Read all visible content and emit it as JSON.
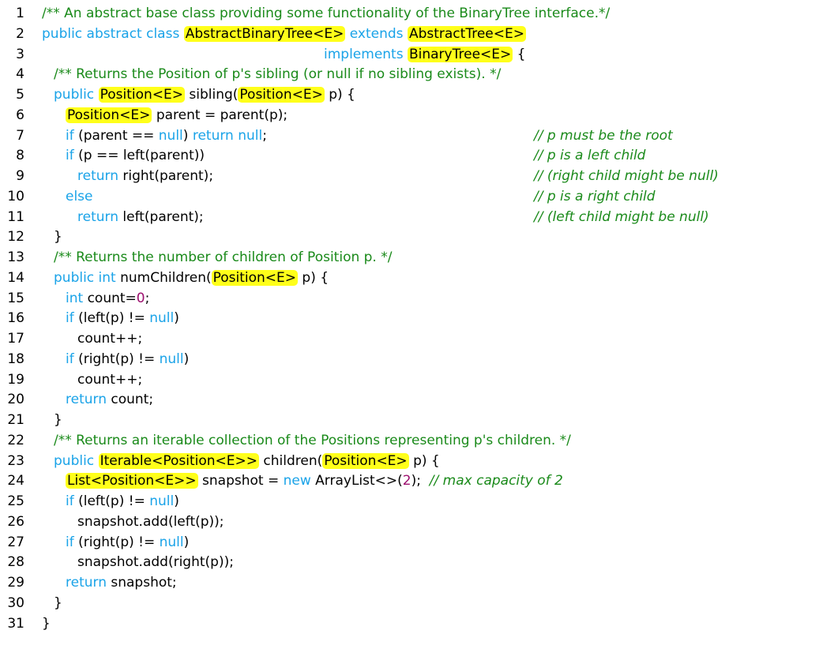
{
  "highlight_color": "#ffff1a",
  "keyword_color": "#1aa3e8",
  "comment_color": "#1a8a1a",
  "number_color": "#9c0f6e",
  "lines": [
    {
      "num": "1",
      "indent": 1,
      "tokens": [
        {
          "t": "/** An abstract base class providing some functionality of the BinaryTree interface.*/",
          "s": "c"
        }
      ]
    },
    {
      "num": "2",
      "indent": 1,
      "tokens": [
        {
          "t": "public abstract class",
          "s": "kw"
        },
        {
          "t": " ",
          "s": ""
        },
        {
          "t": "AbstractBinaryTree<E>",
          "s": "hl"
        },
        {
          "t": " ",
          "s": ""
        },
        {
          "t": "extends",
          "s": "kw"
        },
        {
          "t": " ",
          "s": ""
        },
        {
          "t": "AbstractTree<E>",
          "s": "hl"
        }
      ]
    },
    {
      "num": "3",
      "indent": 22,
      "tokens": [
        {
          "t": "implements",
          "s": "kw"
        },
        {
          "t": " ",
          "s": ""
        },
        {
          "t": "BinaryTree<E>",
          "s": "hl"
        },
        {
          "t": " {",
          "s": ""
        }
      ]
    },
    {
      "num": "4",
      "indent": 2,
      "tokens": [
        {
          "t": "/** Returns the Position of p's sibling (or null if no sibling exists). */",
          "s": "c"
        }
      ]
    },
    {
      "num": "5",
      "indent": 2,
      "tokens": [
        {
          "t": "public",
          "s": "kw"
        },
        {
          "t": " ",
          "s": ""
        },
        {
          "t": "Position<E>",
          "s": "hl"
        },
        {
          "t": " sibling(",
          "s": ""
        },
        {
          "t": "Position<E>",
          "s": "hl"
        },
        {
          "t": " p) {",
          "s": ""
        }
      ]
    },
    {
      "num": "6",
      "indent": 3,
      "tokens": [
        {
          "t": "Position<E>",
          "s": "hl"
        },
        {
          "t": " parent = parent(p);",
          "s": ""
        }
      ],
      "comment": ""
    },
    {
      "num": "7",
      "indent": 3,
      "tokens": [
        {
          "t": "if",
          "s": "kw"
        },
        {
          "t": " (parent == ",
          "s": ""
        },
        {
          "t": "null",
          "s": "kw"
        },
        {
          "t": ") ",
          "s": ""
        },
        {
          "t": "return null",
          "s": "kw"
        },
        {
          "t": ";",
          "s": ""
        }
      ],
      "comment": "// p must be the root"
    },
    {
      "num": "8",
      "indent": 3,
      "tokens": [
        {
          "t": "if",
          "s": "kw"
        },
        {
          "t": " (p == left(parent))",
          "s": ""
        }
      ],
      "comment": "// p is a left child"
    },
    {
      "num": "9",
      "indent": 4,
      "tokens": [
        {
          "t": "return",
          "s": "kw"
        },
        {
          "t": " right(parent);",
          "s": ""
        }
      ],
      "comment": "// (right child might be null)"
    },
    {
      "num": "10",
      "indent": 3,
      "tokens": [
        {
          "t": "else",
          "s": "kw"
        }
      ],
      "comment": "// p is a right child"
    },
    {
      "num": "11",
      "indent": 4,
      "tokens": [
        {
          "t": "return",
          "s": "kw"
        },
        {
          "t": " left(parent);",
          "s": ""
        }
      ],
      "comment": "// (left child might be null)"
    },
    {
      "num": "12",
      "indent": 2,
      "tokens": [
        {
          "t": "}",
          "s": ""
        }
      ]
    },
    {
      "num": "13",
      "indent": 2,
      "tokens": [
        {
          "t": "/** Returns the number of children of Position p. */",
          "s": "c"
        }
      ]
    },
    {
      "num": "14",
      "indent": 2,
      "tokens": [
        {
          "t": "public int",
          "s": "kw"
        },
        {
          "t": " numChildren(",
          "s": ""
        },
        {
          "t": "Position<E>",
          "s": "hl"
        },
        {
          "t": " p) {",
          "s": ""
        }
      ]
    },
    {
      "num": "15",
      "indent": 3,
      "tokens": [
        {
          "t": "int",
          "s": "kw"
        },
        {
          "t": " count=",
          "s": ""
        },
        {
          "t": "0",
          "s": "n"
        },
        {
          "t": ";",
          "s": ""
        }
      ]
    },
    {
      "num": "16",
      "indent": 3,
      "tokens": [
        {
          "t": "if",
          "s": "kw"
        },
        {
          "t": " (left(p) != ",
          "s": ""
        },
        {
          "t": "null",
          "s": "kw"
        },
        {
          "t": ")",
          "s": ""
        }
      ]
    },
    {
      "num": "17",
      "indent": 4,
      "tokens": [
        {
          "t": "count++;",
          "s": ""
        }
      ]
    },
    {
      "num": "18",
      "indent": 3,
      "tokens": [
        {
          "t": "if",
          "s": "kw"
        },
        {
          "t": " (right(p) != ",
          "s": ""
        },
        {
          "t": "null",
          "s": "kw"
        },
        {
          "t": ")",
          "s": ""
        }
      ]
    },
    {
      "num": "19",
      "indent": 4,
      "tokens": [
        {
          "t": "count++;",
          "s": ""
        }
      ]
    },
    {
      "num": "20",
      "indent": 3,
      "tokens": [
        {
          "t": "return",
          "s": "kw"
        },
        {
          "t": " count;",
          "s": ""
        }
      ]
    },
    {
      "num": "21",
      "indent": 2,
      "tokens": [
        {
          "t": "}",
          "s": ""
        }
      ]
    },
    {
      "num": "22",
      "indent": 2,
      "tokens": [
        {
          "t": "/** Returns an iterable collection of the Positions representing p's children. */",
          "s": "c"
        }
      ]
    },
    {
      "num": "23",
      "indent": 2,
      "tokens": [
        {
          "t": "public",
          "s": "kw"
        },
        {
          "t": " ",
          "s": ""
        },
        {
          "t": "Iterable<Position<E>>",
          "s": "hl"
        },
        {
          "t": " children(",
          "s": ""
        },
        {
          "t": "Position<E>",
          "s": "hl"
        },
        {
          "t": " p) {",
          "s": ""
        }
      ]
    },
    {
      "num": "24",
      "indent": 3,
      "tokens": [
        {
          "t": "List<Position<E>>",
          "s": "hl"
        },
        {
          "t": " snapshot = ",
          "s": ""
        },
        {
          "t": "new",
          "s": "kw"
        },
        {
          "t": " ArrayList<>(",
          "s": ""
        },
        {
          "t": "2",
          "s": "n"
        },
        {
          "t": ");  ",
          "s": ""
        },
        {
          "t": "// max capacity of 2",
          "s": "ci"
        }
      ]
    },
    {
      "num": "25",
      "indent": 3,
      "tokens": [
        {
          "t": "if",
          "s": "kw"
        },
        {
          "t": " (left(p) != ",
          "s": ""
        },
        {
          "t": "null",
          "s": "kw"
        },
        {
          "t": ")",
          "s": ""
        }
      ]
    },
    {
      "num": "26",
      "indent": 4,
      "tokens": [
        {
          "t": "snapshot.add(left(p));",
          "s": ""
        }
      ]
    },
    {
      "num": "27",
      "indent": 3,
      "tokens": [
        {
          "t": "if",
          "s": "kw"
        },
        {
          "t": " (right(p) != ",
          "s": ""
        },
        {
          "t": "null",
          "s": "kw"
        },
        {
          "t": ")",
          "s": ""
        }
      ]
    },
    {
      "num": "28",
      "indent": 4,
      "tokens": [
        {
          "t": "snapshot.add(right(p));",
          "s": ""
        }
      ]
    },
    {
      "num": "29",
      "indent": 3,
      "tokens": [
        {
          "t": "return",
          "s": "kw"
        },
        {
          "t": " snapshot;",
          "s": ""
        }
      ]
    },
    {
      "num": "30",
      "indent": 2,
      "tokens": [
        {
          "t": "}",
          "s": ""
        }
      ]
    },
    {
      "num": "31",
      "indent": 1,
      "tokens": [
        {
          "t": "}",
          "s": ""
        }
      ]
    }
  ]
}
